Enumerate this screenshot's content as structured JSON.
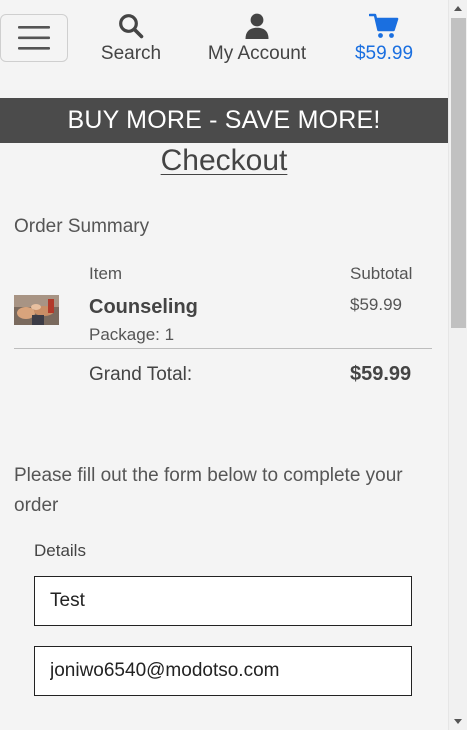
{
  "header": {
    "menu_icon": "hamburger-menu-icon",
    "search": {
      "icon": "search-icon",
      "label": "Search"
    },
    "account": {
      "icon": "user-icon",
      "label": "My Account"
    },
    "cart": {
      "icon": "cart-icon",
      "label": "$59.99",
      "color": "#1a6fe0"
    }
  },
  "promo": {
    "text": "BUY MORE - SAVE MORE!",
    "background": "#4b4b4b"
  },
  "checkout": {
    "title": "Checkout"
  },
  "order_summary": {
    "title": "Order Summary",
    "columns": {
      "item": "Item",
      "subtotal": "Subtotal"
    },
    "items": [
      {
        "name": "Counseling",
        "package": "Package: 1",
        "subtotal": "$59.99",
        "thumbnail": "counseling-thumbnail"
      }
    ],
    "grand_total_label": "Grand Total:",
    "grand_total_value": "$59.99"
  },
  "form": {
    "intro": "Please fill out the form below to complete your order",
    "details_label": "Details",
    "name_value": "Test",
    "email_value": "joniwo6540@modotso.com"
  }
}
